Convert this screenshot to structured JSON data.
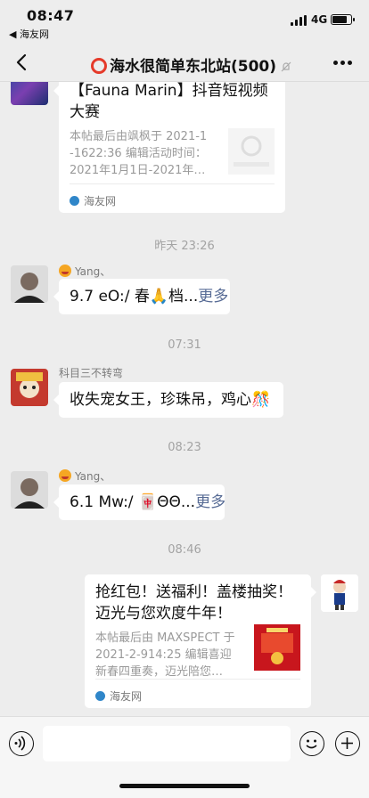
{
  "status_bar": {
    "time": "08:47",
    "back_app": "◀ 海友网",
    "network": "4G",
    "battery_level": 0.85
  },
  "header": {
    "title": "海水很简单东北站(500)"
  },
  "messages": {
    "card1": {
      "title": "【Fauna Marin】抖音短视频大赛",
      "title_line1": "【Fauna Marin】抖音短视频",
      "title_line2": "大赛",
      "desc_line1": "本帖最后由飒枫于 2021-1",
      "desc_line2": "-1622:36 编辑活动时间：",
      "desc_line3": "2021年1月1日-2021年…",
      "source": "海友网"
    },
    "time1": "昨天 23:26",
    "msg1": {
      "sender": "Yang、",
      "text": "9.7 eO:/ 春🙏档...",
      "more": "更多"
    },
    "time2": "07:31",
    "msg2": {
      "sender": "科目三不转弯",
      "text": "收失宠女王，珍珠吊，鸡心🎊"
    },
    "time3": "08:23",
    "msg3": {
      "sender": "Yang、",
      "text": "6.1 Mw:/ 🀄ΘΘ...",
      "more": "更多"
    },
    "time4": "08:46",
    "card2": {
      "title_line1": "抢红包！送福利！盖楼抽奖！",
      "title_line2": "迈光与您欢度牛年！",
      "desc_line1": "本帖最后由 MAXSPECT 于",
      "desc_line2": "2021-2-914:25 编辑喜迎",
      "desc_line3": "新春四重奏，迈光陪您…",
      "source": "海友网"
    }
  },
  "input": {
    "placeholder": ""
  },
  "colors": {
    "background": "#ededed",
    "bubble": "#ffffff",
    "link": "#576b95",
    "accent_red": "#e53a2a"
  }
}
